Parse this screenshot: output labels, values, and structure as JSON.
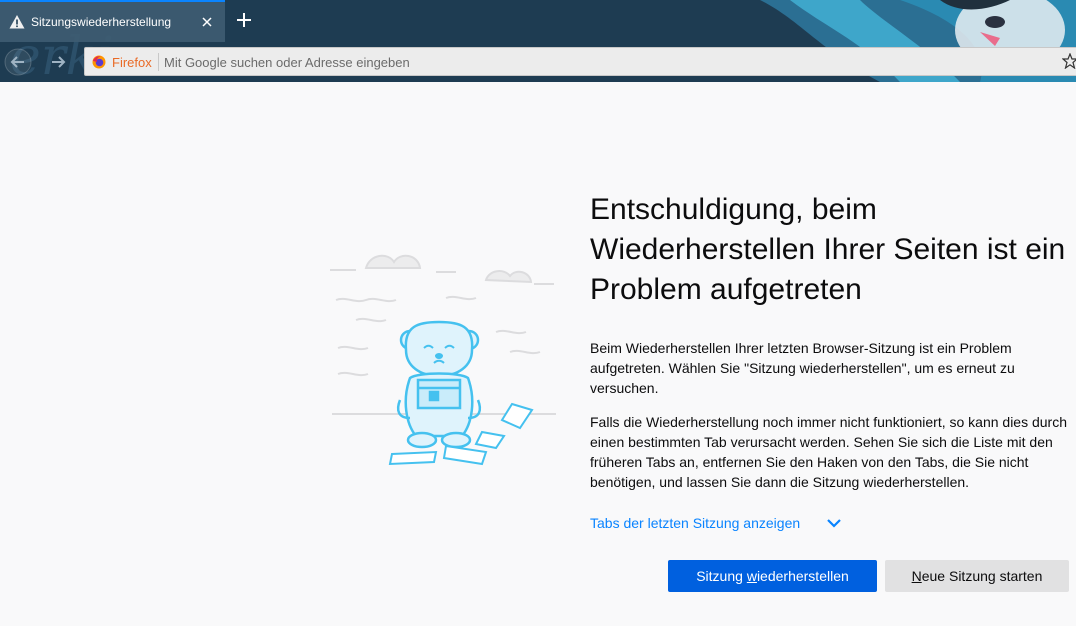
{
  "tab": {
    "title": "Sitzungswiederherstellung",
    "icon": "warning-icon"
  },
  "urlbar": {
    "identity_label": "Firefox",
    "placeholder": "Mit Google suchen oder Adresse eingeben"
  },
  "content": {
    "heading": "Entschuldigung, beim Wiederherstellen Ihrer Seiten ist ein Problem aufgetreten",
    "paragraph1": "Beim Wiederherstellen Ihrer letzten Browser-Sitzung ist ein Problem aufgetreten. Wählen Sie \"Sitzung wiederherstellen\", um es erneut zu versuchen.",
    "paragraph2": "Falls die Wiederherstellung noch immer nicht funktioniert, so kann dies durch einen bestimmten Tab verursacht werden. Sehen Sie sich die Liste mit den früheren Tabs an, entfernen Sie den Haken von den Tabs, die Sie nicht benötigen, und lassen Sie dann die Sitzung wiederherstellen.",
    "show_tabs_label": "Tabs der letzten Sitzung anzeigen"
  },
  "buttons": {
    "restore_pre": "Sitzung ",
    "restore_key": "w",
    "restore_post": "iederherstellen",
    "new_key": "N",
    "new_post": "eue Sitzung starten"
  },
  "colors": {
    "accent_blue": "#0060df",
    "link_blue": "#0a84ff",
    "chrome_dark": "#1e3c52",
    "firefox_orange": "#e96a26"
  }
}
